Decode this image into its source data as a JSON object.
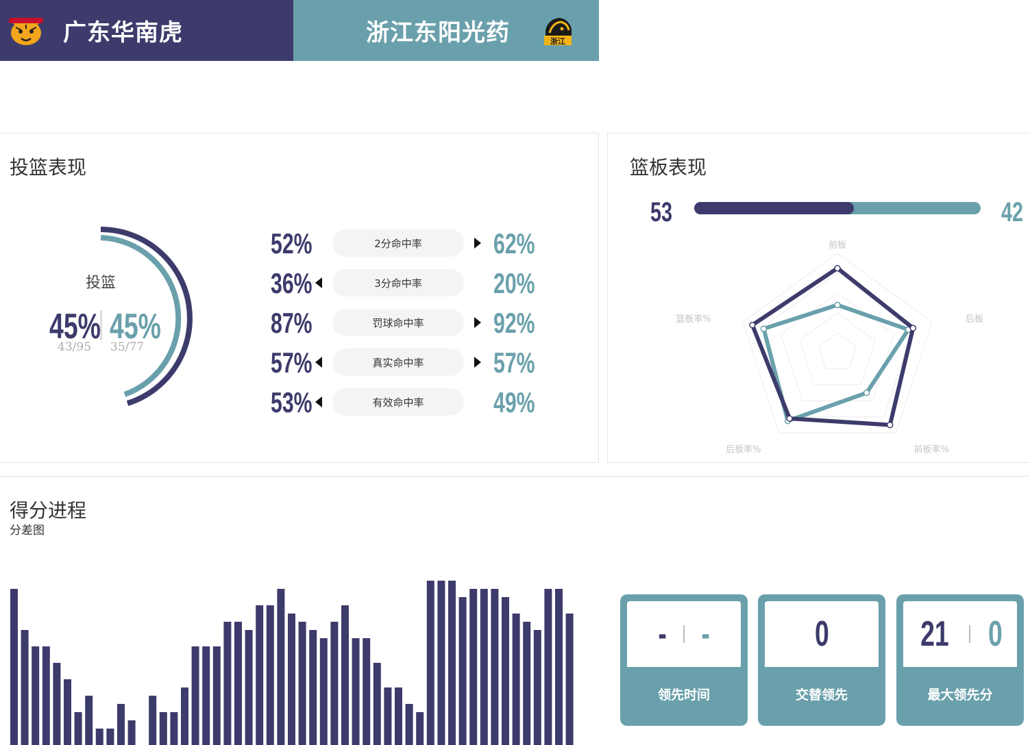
{
  "header": {
    "home_team": "广东华南虎",
    "away_team": "浙江东阳光药",
    "home_logo_icon": "tiger-logo-icon",
    "away_logo_icon": "lion-logo-icon",
    "home_logo_text": "",
    "away_logo_text": "浙江"
  },
  "colors": {
    "home": "#3d3b6b",
    "away": "#6aa0ab"
  },
  "shooting": {
    "title": "投篮表现",
    "donut_label": "投篮",
    "home_pct": "45%",
    "away_pct": "45%",
    "home_frac": "43/95",
    "away_frac": "35/77",
    "rows": [
      {
        "label": "2分命中率",
        "home": "52%",
        "away": "62%",
        "arrow": "right"
      },
      {
        "label": "3分命中率",
        "home": "36%",
        "away": "20%",
        "arrow": "left"
      },
      {
        "label": "罚球命中率",
        "home": "87%",
        "away": "92%",
        "arrow": "right"
      },
      {
        "label": "真实命中率",
        "home": "57%",
        "away": "57%",
        "arrow": "both"
      },
      {
        "label": "有效命中率",
        "home": "53%",
        "away": "49%",
        "arrow": "left"
      }
    ]
  },
  "rebounds": {
    "title": "篮板表现",
    "home_total": "53",
    "away_total": "42",
    "radar_axes": [
      "前板",
      "后板",
      "前板率%",
      "后板率%",
      "篮板率%"
    ],
    "home_radar": [
      0.85,
      0.8,
      0.9,
      0.82,
      0.9
    ],
    "away_radar": [
      0.48,
      0.75,
      0.5,
      0.85,
      0.78
    ]
  },
  "score_progress": {
    "title": "得分进程",
    "subtitle": "分差图",
    "diff_values": [
      19,
      14,
      12,
      12,
      10,
      8,
      4,
      6,
      2,
      2,
      5,
      3,
      6,
      4,
      4,
      7,
      12,
      12,
      12,
      15,
      15,
      14,
      17,
      17,
      19,
      16,
      15,
      14,
      13,
      15,
      17,
      13,
      13,
      10,
      7,
      7,
      5,
      4,
      20,
      20,
      20,
      18,
      19,
      19,
      19,
      18,
      16,
      15,
      14,
      19,
      19,
      16
    ],
    "cards": [
      {
        "label": "领先时间",
        "home": "-",
        "away": "-",
        "split": true
      },
      {
        "label": "交替领先",
        "home": "0",
        "away": "",
        "split": false
      },
      {
        "label": "最大领先分",
        "home": "21",
        "away": "0",
        "split": true
      }
    ]
  }
}
